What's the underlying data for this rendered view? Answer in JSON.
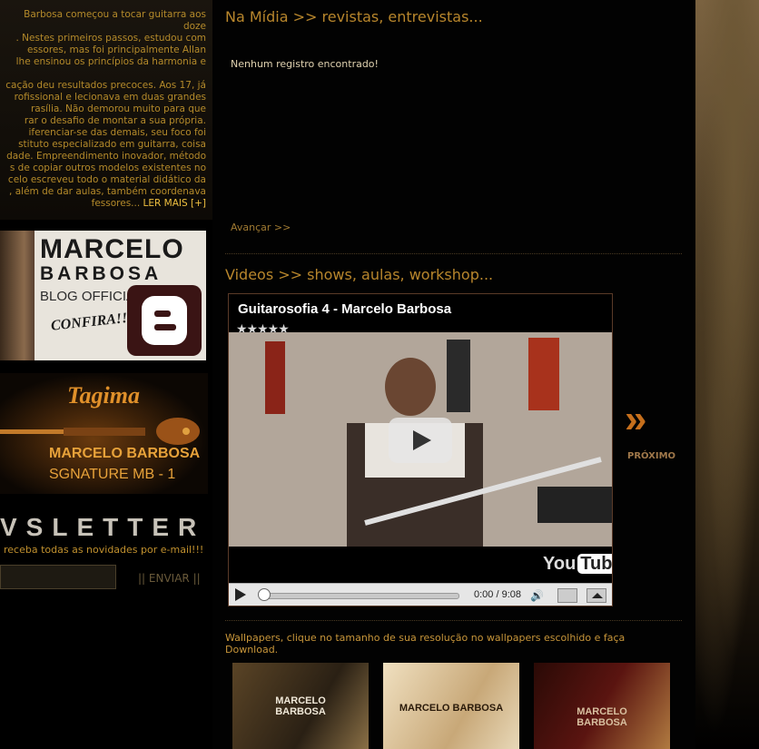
{
  "bio": {
    "text": "Barbosa começou a tocar guitarra aos doze\n. Nestes primeiros passos, estudou com\nessores, mas foi principalmente Allan\nlhe ensinou os princípios da harmonia e\n\ncação deu resultados precoces. Aos 17, já\nrofissional e lecionava em duas grandes\nrasília. Não demorou muito para que\nrar o desafio de montar a sua própria.\niferenciar-se das demais, seu foco foi\nstituto especializado em guitarra, coisa\ndade. Empreendimento inovador, método\ns de copiar outros modelos existentes no\ncelo escreveu todo o material didático da\n, além de dar aulas, também coordenava\nfessores...",
    "read_more": "LER MAIS [+]"
  },
  "blog_banner": {
    "name_first": "MARCELO",
    "name_last": "BARBOSA",
    "subtitle": "BLOG OFFICIAL",
    "cta": "CONFIRA!!!"
  },
  "tagima_banner": {
    "brand": "Tagima",
    "name": "MARCELO BARBOSA",
    "signature": "SGNATURE  MB - 1"
  },
  "newsletter": {
    "title": "VSLETTER",
    "subtitle": "receba todas as novidades por e-mail!!!",
    "input_value": "",
    "send_label": "|| ENVIAR ||"
  },
  "media": {
    "title": "Na Mídia >> revistas, entrevistas...",
    "empty_message": "Nenhum registro encontrado!",
    "next_link": "Avançar >>"
  },
  "videos": {
    "title": "Videos >> shows, aulas, workshop...",
    "player": {
      "video_title": "Guitarosofia 4 - Marcelo Barbosa",
      "rating_stars": "★★★★★",
      "rating": 4.5,
      "time": "0:00 / 9:08",
      "youtube_you": "You",
      "youtube_tube": "Tube"
    },
    "next_label": "PRÓXIMO"
  },
  "wallpapers": {
    "text": "Wallpapers, clique no tamanho de sua resolução no wallpapers escolhido e faça Download.",
    "thumbs": [
      {
        "label": "MARCELO\nBARBOSA"
      },
      {
        "label": "MARCELO BARBOSA"
      },
      {
        "label": "MARCELO\nBARBOSA"
      }
    ]
  },
  "colors": {
    "accent": "#b8862c",
    "background": "#000000",
    "link": "#f0c040"
  }
}
